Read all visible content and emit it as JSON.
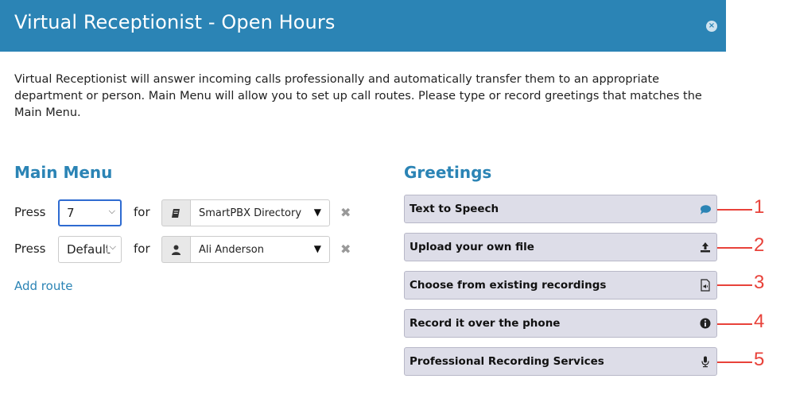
{
  "dialog": {
    "title": "Virtual Receptionist - Open Hours",
    "close_symbol": "×"
  },
  "intro_text": "Virtual Receptionist will answer incoming calls professionally and automatically transfer them to an appropriate department or person. Main Menu will allow you to set up call routes. Please type or record greetings that matches the Main Menu.",
  "main_menu": {
    "title": "Main Menu",
    "routes": [
      {
        "press_label": "Press",
        "key_value": "7",
        "for_label": "for",
        "dest_icon": "directory-book-icon",
        "destination": "SmartPBX Directory",
        "caret": "▼",
        "remove": "✖"
      },
      {
        "press_label": "Press",
        "key_value": "Default",
        "for_label": "for",
        "dest_icon": "user-icon",
        "destination": "Ali Anderson",
        "caret": "▼",
        "remove": "✖"
      }
    ],
    "add_route": "Add route",
    "chevron": "⌵"
  },
  "greetings": {
    "title": "Greetings",
    "options": [
      {
        "label": "Text to Speech",
        "icon": "speech-bubble-icon",
        "callout": "1"
      },
      {
        "label": "Upload your own file",
        "icon": "upload-icon",
        "callout": "2"
      },
      {
        "label": "Choose from existing recordings",
        "icon": "audio-file-icon",
        "callout": "3"
      },
      {
        "label": "Record it over the phone",
        "icon": "info-icon",
        "callout": "4"
      },
      {
        "label": "Professional Recording Services",
        "icon": "microphone-icon",
        "callout": "5"
      }
    ]
  },
  "colors": {
    "header": "#2b84b5",
    "accent": "#2b84b5",
    "callout": "#e8423a",
    "button_bg": "#dddde8"
  }
}
